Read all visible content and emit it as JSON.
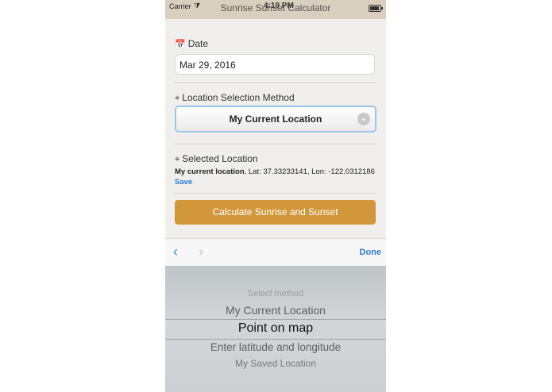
{
  "status_bar": {
    "carrier": "Carrier",
    "time": "4:19 PM",
    "title": "Sunrise Sunset Calculator"
  },
  "date_section": {
    "label": "Date",
    "value": "Mar 29, 2016"
  },
  "location_method_section": {
    "label": "Location Selection Method",
    "selected": "My Current Location"
  },
  "selected_location_section": {
    "label": "Selected Location",
    "name": "My current location",
    "coords": ", Lat: 37.33233141, Lon: -122.0312186",
    "save_label": "Save"
  },
  "calculate_button": {
    "label": "Calculate Sunrise and Sunset"
  },
  "keyboard_toolbar": {
    "done_label": "Done"
  },
  "picker": {
    "options": [
      "Select method",
      "My Current Location",
      "Point on map",
      "Enter latitude and longitude",
      "My Saved Location"
    ],
    "selected_index": 2
  },
  "colors": {
    "accent_button": "#d1973a",
    "link": "#2b7bd8",
    "select_border": "#9ec5ea",
    "status_bar_bg": "#d8cfbf"
  }
}
